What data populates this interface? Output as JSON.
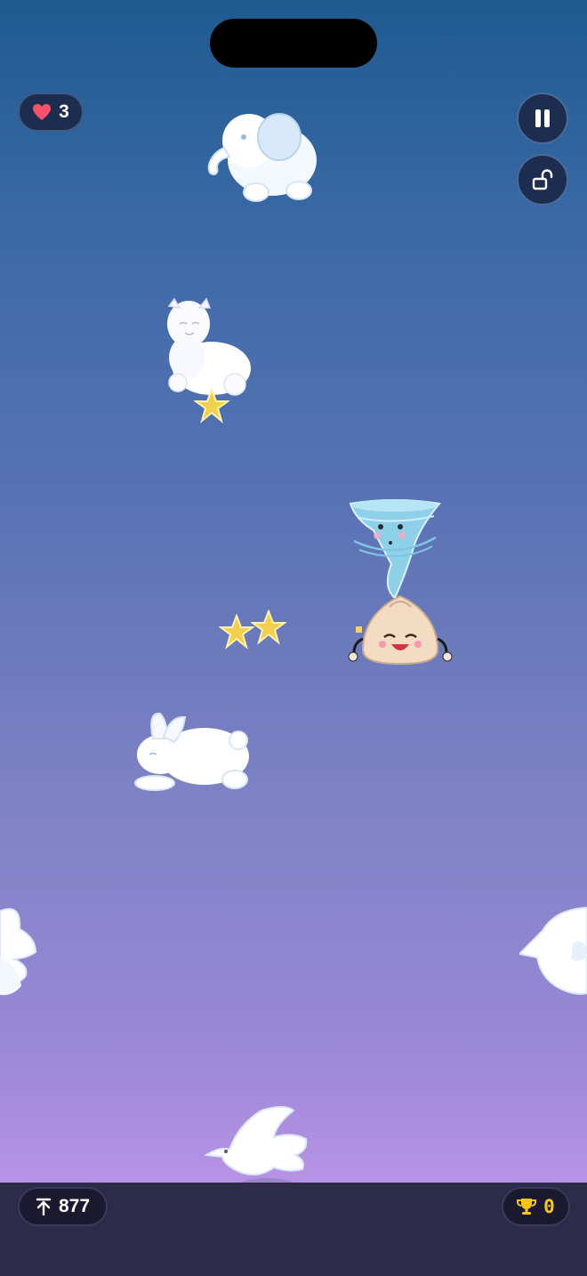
{
  "hud": {
    "lives": "3",
    "height_score": "877",
    "trophies": "0"
  },
  "icons": {
    "lives": "heart-icon",
    "pause": "pause-icon",
    "unlock": "unlock-icon",
    "height": "arrow-up-icon",
    "trophy": "trophy-icon"
  },
  "colors": {
    "heart": "#f2526a",
    "trophy": "#f5c518",
    "hud_bg": "#1d2d4f",
    "bottom_bar": "#2d2a4a"
  }
}
